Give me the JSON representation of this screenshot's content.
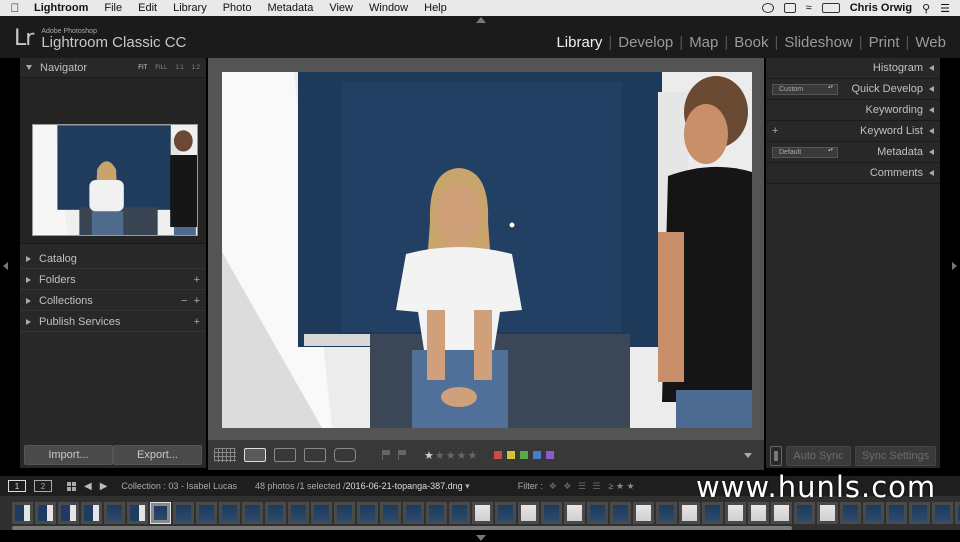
{
  "menubar": {
    "app": "Lightroom",
    "items": [
      "File",
      "Edit",
      "Library",
      "Photo",
      "Metadata",
      "View",
      "Window",
      "Help"
    ],
    "user": "Chris Orwig"
  },
  "identity": {
    "logo": "Lr",
    "adobe": "Adobe Photoshop",
    "product": "Lightroom Classic CC"
  },
  "modules": [
    "Library",
    "Develop",
    "Map",
    "Book",
    "Slideshow",
    "Print",
    "Web"
  ],
  "left_panel": {
    "navigator": {
      "title": "Navigator",
      "zoom_options": [
        "FIT",
        "FILL",
        "1:1",
        "1:2"
      ]
    },
    "sections": [
      "Catalog",
      "Folders",
      "Collections",
      "Publish Services"
    ],
    "import_label": "Import...",
    "export_label": "Export..."
  },
  "right_panel": {
    "histogram": "Histogram",
    "quick_develop": "Quick Develop",
    "quick_develop_preset": "Custom",
    "keywording": "Keywording",
    "keyword_list": "Keyword List",
    "metadata": "Metadata",
    "metadata_preset": "Default",
    "comments": "Comments",
    "auto_sync": "Auto Sync",
    "sync_settings": "Sync Settings"
  },
  "toolbar": {
    "rating": 1,
    "label_colors": [
      "#cc4b4b",
      "#d6c23a",
      "#5aa84a",
      "#4a7ac8",
      "#8a5ac8"
    ]
  },
  "filmbar": {
    "screen1": "1",
    "screen2": "2",
    "collection": "Collection : 03 - Isabel Lucas",
    "count": "48 photos /1 selected /",
    "file": "2016-06-21-topanga-387.dng",
    "filter_label": "Filter :"
  },
  "filmstrip": {
    "thumbs": [
      "mix",
      "mix",
      "mix",
      "mix",
      "dark",
      "mix",
      "dark",
      "dark",
      "dark",
      "dark",
      "dark",
      "dark",
      "dark",
      "dark",
      "dark",
      "dark",
      "dark",
      "dark",
      "dark",
      "dark",
      "light",
      "dark",
      "light",
      "dark",
      "light",
      "dark",
      "dark",
      "light",
      "dark",
      "light",
      "dark",
      "light",
      "light",
      "light",
      "dark",
      "light",
      "dark",
      "dark",
      "dark",
      "dark",
      "dark",
      "mix"
    ],
    "selected_index": 6
  },
  "watermark": "www.hunls.com"
}
